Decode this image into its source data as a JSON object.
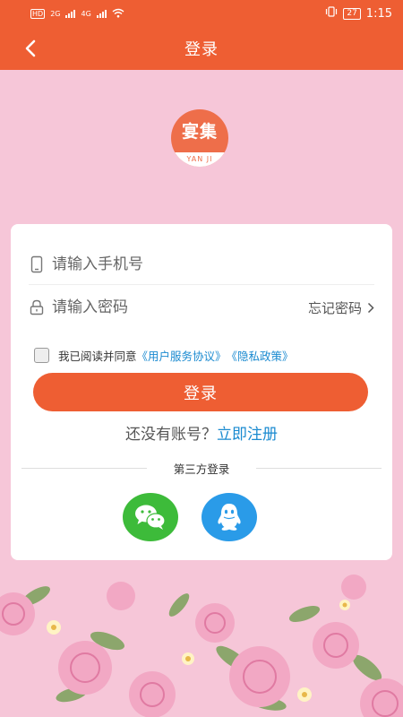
{
  "status_bar": {
    "left_badge": "HD",
    "net1": "2G",
    "net2": "4G",
    "battery": "27",
    "time": "1:15"
  },
  "nav": {
    "title": "登录",
    "back_icon": "chevron-left-icon"
  },
  "logo": {
    "main": "宴集",
    "sub": "YAN JI"
  },
  "form": {
    "phone_placeholder": "请输入手机号",
    "password_placeholder": "请输入密码",
    "forgot_label": "忘记密码",
    "agree_prefix": "我已阅读并同意",
    "user_agreement": "《用户服务协议》",
    "privacy_policy": "《隐私政策》",
    "login_label": "登录",
    "no_account": "还没有账号？",
    "register_label": "立即注册",
    "third_party_label": "第三方登录"
  },
  "colors": {
    "brand": "#ee5e33",
    "link": "#1a8ad0",
    "background": "#f6c6d8",
    "wechat": "#3dbb3a",
    "qq": "#2a9be8"
  }
}
